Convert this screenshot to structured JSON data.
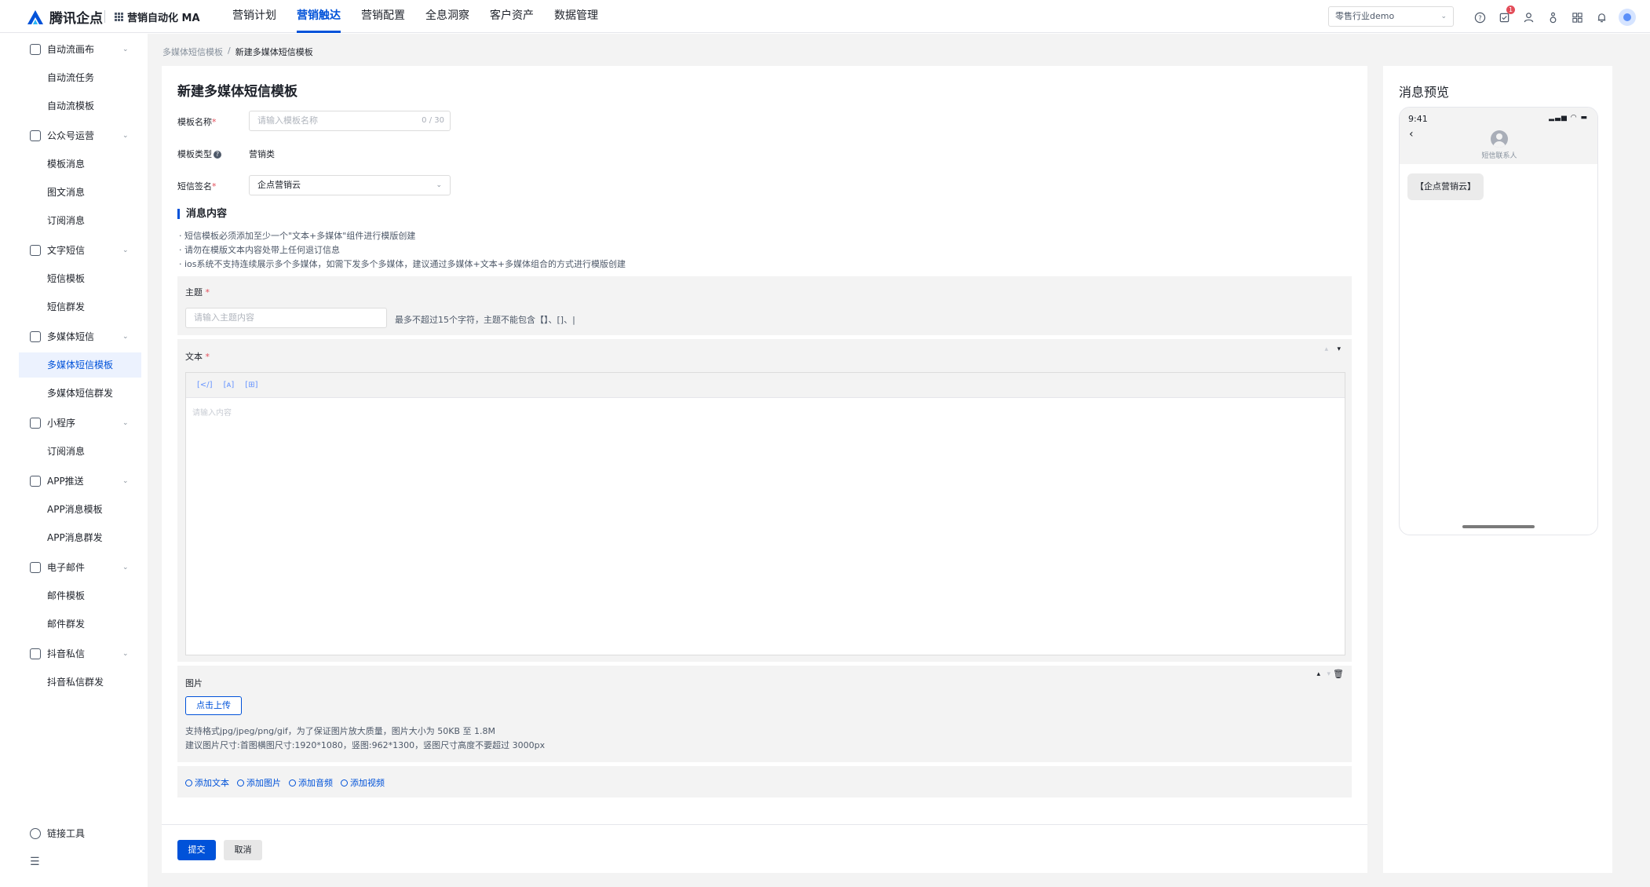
{
  "header": {
    "brand": "腾讯企点",
    "app_name": "营销自动化 MA",
    "menu": [
      "营销计划",
      "营销触达",
      "营销配置",
      "全息洞察",
      "客户资产",
      "数据管理"
    ],
    "active_menu": "营销触达",
    "org_select": "零售行业demo",
    "notification_count": "1",
    "accent_color": "#0052d9"
  },
  "sidebar": {
    "groups": [
      {
        "label": "自动流画布",
        "icon": "flow-icon",
        "items": [
          "自动流任务",
          "自动流模板"
        ]
      },
      {
        "label": "公众号运营",
        "icon": "wechat-icon",
        "items": [
          "模板消息",
          "图文消息",
          "订阅消息"
        ]
      },
      {
        "label": "文字短信",
        "icon": "sms-icon",
        "items": [
          "短信模板",
          "短信群发"
        ]
      },
      {
        "label": "多媒体短信",
        "icon": "mms-icon",
        "items": [
          "多媒体短信模板",
          "多媒体短信群发"
        ]
      },
      {
        "label": "小程序",
        "icon": "miniprogram-icon",
        "items": [
          "订阅消息"
        ]
      },
      {
        "label": "APP推送",
        "icon": "app-icon",
        "items": [
          "APP消息模板",
          "APP消息群发"
        ]
      },
      {
        "label": "电子邮件",
        "icon": "mail-icon",
        "items": [
          "邮件模板",
          "邮件群发"
        ]
      },
      {
        "label": "抖音私信",
        "icon": "douyin-icon",
        "items": [
          "抖音私信群发"
        ]
      }
    ],
    "active_item": "多媒体短信模板",
    "link_tool": "链接工具",
    "collapse_icon": "collapse-menu-icon"
  },
  "breadcrumb": {
    "parent": "多媒体短信模板",
    "separator": "/",
    "current": "新建多媒体短信模板"
  },
  "form": {
    "title": "新建多媒体短信模板",
    "name_label": "模板名称",
    "name_placeholder": "请输入模板名称",
    "name_count": "0 / 30",
    "type_label": "模板类型",
    "type_value": "营销类",
    "sign_label": "短信签名",
    "sign_value": "企点营销云",
    "section_title": "消息内容",
    "tips": [
      "· 短信模板必须添加至少一个\"文本+多媒体\"组件进行模版创建",
      "· 请勿在模版文本内容处带上任何退订信息",
      "· ios系统不支持连续展示多个多媒体，如需下发多个多媒体，建议通过多媒体+文本+多媒体组合的方式进行模版创建"
    ],
    "subject_label": "主题",
    "subject_placeholder": "请输入主题内容",
    "subject_hint": "最多不超过15个字符，主题不能包含【】、[]、|",
    "text_label": "文本",
    "toolbar": [
      "[</]",
      "[ᴀ]",
      "[⊞]"
    ],
    "text_placeholder": "请输入内容",
    "image_label": "图片",
    "upload_label": "点击上传",
    "image_hints": [
      "支持格式jpg/jpeg/png/gif，为了保证图片放大质量，图片大小为 50KB 至 1.8M",
      "建议图片尺寸:首图横图尺寸:1920*1080，竖图:962*1300，竖图尺寸高度不要超过 3000px"
    ],
    "add_links": [
      "添加文本",
      "添加图片",
      "添加音频",
      "添加视频"
    ]
  },
  "footer": {
    "submit": "提交",
    "cancel": "取消"
  },
  "preview": {
    "title": "消息预览",
    "time": "9:41",
    "contact": "短信联系人",
    "bubble": "【企点营销云】"
  }
}
